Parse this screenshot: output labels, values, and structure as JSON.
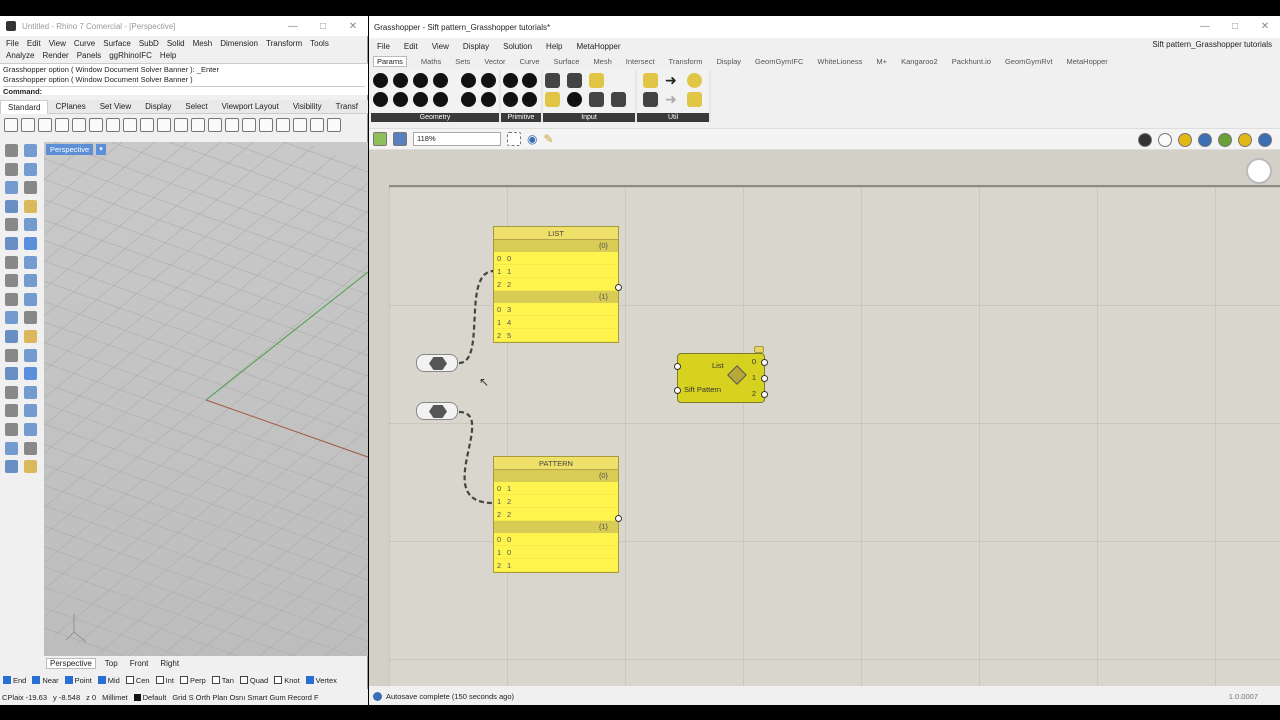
{
  "rhino": {
    "title": "Untitled - Rhino 7 Comercial - [Perspective]",
    "menu": [
      "File",
      "Edit",
      "View",
      "Curve",
      "Surface",
      "SubD",
      "Solid",
      "Mesh",
      "Dimension",
      "Transform",
      "Tools"
    ],
    "menu2": [
      "Analyze",
      "Render",
      "Panels",
      "ggRhinoIFC",
      "Help"
    ],
    "command_history": [
      "Grasshopper option ( Window  Document  Solver  Banner ): _Enter",
      "Grasshopper option ( Window  Document  Solver  Banner )"
    ],
    "command_label": "Command:",
    "tabs": [
      "Standard",
      "CPlanes",
      "Set View",
      "Display",
      "Select",
      "Viewport Layout",
      "Visibility",
      "Transf"
    ],
    "viewport_label": "Perspective",
    "view_tabs": [
      "Perspective",
      "Top",
      "Front",
      "Right"
    ],
    "osnaps": [
      {
        "label": "End",
        "on": true
      },
      {
        "label": "Near",
        "on": true
      },
      {
        "label": "Point",
        "on": true
      },
      {
        "label": "Mid",
        "on": true
      },
      {
        "label": "Cen",
        "on": false
      },
      {
        "label": "Int",
        "on": false
      },
      {
        "label": "Perp",
        "on": false
      },
      {
        "label": "Tan",
        "on": false
      },
      {
        "label": "Quad",
        "on": false
      },
      {
        "label": "Knot",
        "on": false
      },
      {
        "label": "Vertex",
        "on": true
      }
    ],
    "status": {
      "cplane": "CPlaix -19.63",
      "y": "y -8.548",
      "z": "z 0",
      "units": "Millimet",
      "layer": "Default",
      "modes": "Grid S Orth Plan Osnı Smart Gum Record F"
    }
  },
  "gh": {
    "title": "Grasshopper - Sift pattern_Grasshopper tutorials*",
    "doc_name": "Sift pattern_Grasshopper tutorials",
    "menu": [
      "File",
      "Edit",
      "View",
      "Display",
      "Solution",
      "Help",
      "MetaHopper"
    ],
    "tabs": [
      "Params",
      "Maths",
      "Sets",
      "Vector",
      "Curve",
      "Surface",
      "Mesh",
      "Intersect",
      "Transform",
      "Display",
      "GeomGymIFC",
      "WhiteLioness",
      "M+",
      "Kangaroo2",
      "Packhunt.io",
      "GeomGymRvt",
      "MetaHopper"
    ],
    "ribbon_groups": [
      "Geometry",
      "Primitive",
      "Input",
      "Util"
    ],
    "zoom": "118%",
    "list_panel": {
      "title": "LIST",
      "branches": [
        {
          "path": "{0}",
          "items": [
            {
              "i": "0",
              "v": "0"
            },
            {
              "i": "1",
              "v": "1"
            },
            {
              "i": "2",
              "v": "2"
            }
          ]
        },
        {
          "path": "{1}",
          "items": [
            {
              "i": "0",
              "v": "3"
            },
            {
              "i": "1",
              "v": "4"
            },
            {
              "i": "2",
              "v": "5"
            }
          ]
        }
      ]
    },
    "pattern_panel": {
      "title": "PATTERN",
      "branches": [
        {
          "path": "{0}",
          "items": [
            {
              "i": "0",
              "v": "1"
            },
            {
              "i": "1",
              "v": "2"
            },
            {
              "i": "2",
              "v": "2"
            }
          ]
        },
        {
          "path": "{1}",
          "items": [
            {
              "i": "0",
              "v": "0"
            },
            {
              "i": "1",
              "v": "0"
            },
            {
              "i": "2",
              "v": "1"
            }
          ]
        }
      ]
    },
    "component": {
      "input_list": "List",
      "input_pattern": "Sift Pattern",
      "outputs": [
        "0",
        "1",
        "2"
      ]
    },
    "status": "Autosave complete (150 seconds ago)",
    "version": "1.0.0007"
  },
  "colors": {
    "panel_yellow": "#fff34d",
    "component": "#d6d21f",
    "canvas": "#d8d6cd",
    "accent": "#2a6fd6"
  }
}
